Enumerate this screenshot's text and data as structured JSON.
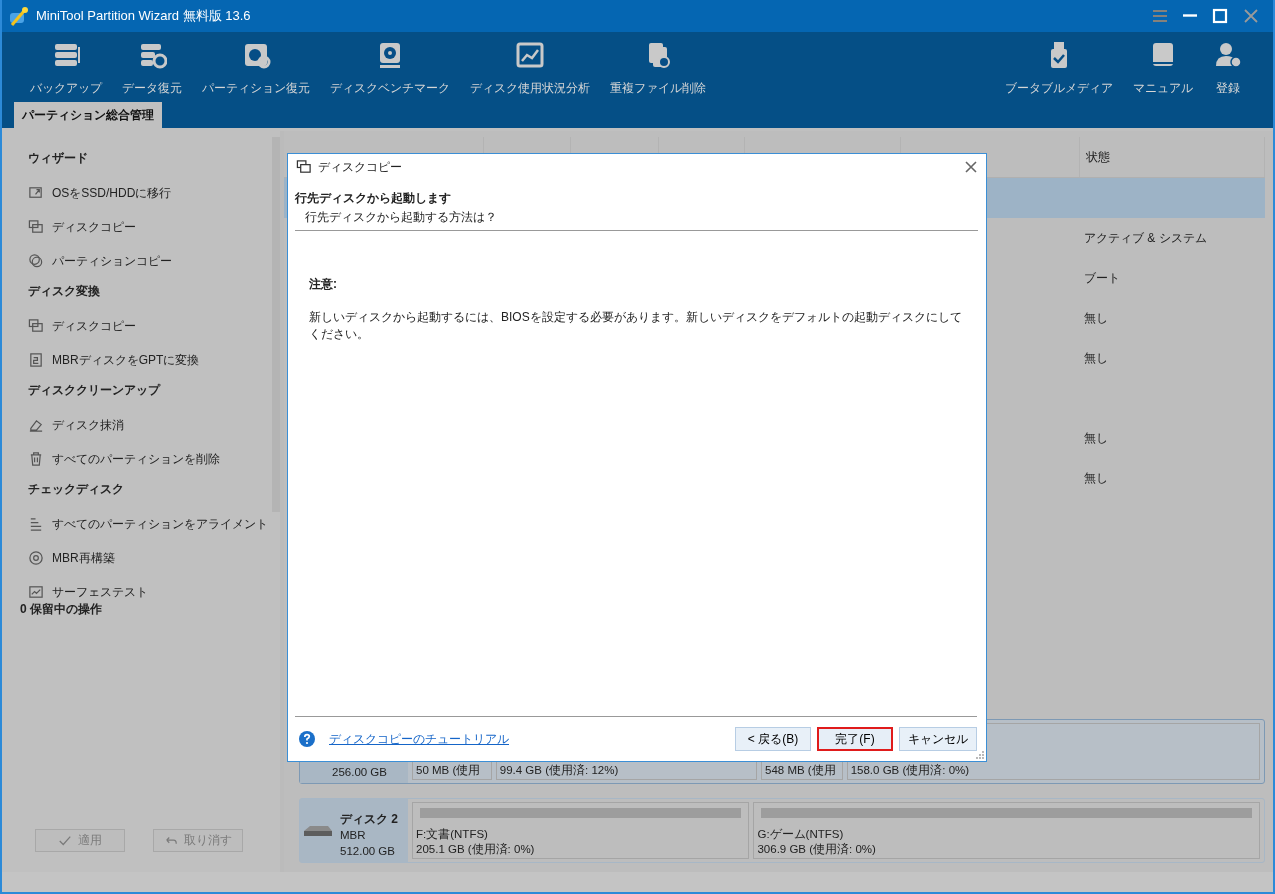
{
  "window": {
    "title": "MiniTool Partition Wizard 無料版 13.6"
  },
  "toolbar": {
    "left": [
      {
        "label": "バックアップ",
        "kind": "stack"
      },
      {
        "label": "データ復元",
        "kind": "datarecover"
      },
      {
        "label": "パーティション復元",
        "kind": "partrecover"
      },
      {
        "label": "ディスクベンチマーク",
        "kind": "benchmark"
      },
      {
        "label": "ディスク使用状況分析",
        "kind": "chart"
      },
      {
        "label": "重複ファイル削除",
        "kind": "duplicate"
      }
    ],
    "right": [
      {
        "label": "ブータブルメディア",
        "kind": "usb"
      },
      {
        "label": "マニュアル",
        "kind": "book"
      },
      {
        "label": "登録",
        "kind": "user"
      }
    ]
  },
  "tabs": [
    {
      "label": "パーティション総合管理",
      "selected": true
    }
  ],
  "sidebar": {
    "sections": [
      {
        "title": "ウィザード",
        "items": [
          {
            "label": "OSをSSD/HDDに移行",
            "kind": "migrate"
          },
          {
            "label": "ディスクコピー",
            "kind": "diskcopy"
          },
          {
            "label": "パーティションコピー",
            "kind": "partcopy"
          }
        ]
      },
      {
        "title": "ディスク変換",
        "items": [
          {
            "label": "ディスクコピー",
            "kind": "diskcopy"
          },
          {
            "label": "MBRディスクをGPTに変換",
            "kind": "convert"
          }
        ]
      },
      {
        "title": "ディスククリーンアップ",
        "items": [
          {
            "label": "ディスク抹消",
            "kind": "eraser"
          },
          {
            "label": "すべてのパーティションを削除",
            "kind": "trash"
          }
        ]
      },
      {
        "title": "チェックディスク",
        "items": [
          {
            "label": "すべてのパーティションをアライメント",
            "kind": "align"
          },
          {
            "label": "MBR再構築",
            "kind": "rebuild"
          },
          {
            "label": "サーフェステスト",
            "kind": "surface"
          }
        ]
      }
    ],
    "pending": "0 保留中の操作",
    "buttons": [
      {
        "label": "適用",
        "kind": "apply",
        "disabled": true
      },
      {
        "label": "取り消す",
        "kind": "undo",
        "disabled": true
      }
    ]
  },
  "table": {
    "columns": [
      {
        "label": "状態"
      }
    ],
    "rows": [
      {
        "selected": true
      },
      {
        "status": "アクティブ & システム",
        "selected": false
      },
      {
        "status": "ブート",
        "selected": false
      },
      {
        "status": "無し",
        "selected": false
      },
      {
        "status": "無し",
        "selected": false
      },
      {
        "selected": false
      },
      {
        "status": "無し",
        "selected": false
      },
      {
        "status": "無し",
        "selected": false
      }
    ]
  },
  "disk_map": {
    "disks": [
      {
        "size": "256.00 GB",
        "selected": true,
        "partitions": [
          {
            "detail": "50 MB (使用"
          },
          {
            "detail": "99.4 GB (使用済: 12%)"
          },
          {
            "detail": "548 MB (使用"
          },
          {
            "detail": "158.0 GB (使用済: 0%)"
          }
        ]
      },
      {
        "name": "ディスク 2",
        "type": "MBR",
        "size": "512.00 GB",
        "selected": false,
        "partitions": [
          {
            "label": "F:文書(NTFS)",
            "detail": "205.1 GB (使用済: 0%)"
          },
          {
            "label": "G:ゲーム(NTFS)",
            "detail": "306.9 GB (使用済: 0%)"
          }
        ]
      }
    ]
  },
  "dialog": {
    "title": "ディスクコピー",
    "heading": "行先ディスクから起動します",
    "subheading": "行先ディスクから起動する方法は？",
    "note_title": "注意:",
    "note": "新しいディスクから起動するには、BIOSを設定する必要があります。新しいディスクをデフォルトの起動ディスクにしてください。",
    "help_link": "ディスクコピーのチュートリアル",
    "buttons": [
      {
        "label": "< 戻る(B)",
        "focused": false
      },
      {
        "label": "完了(F)",
        "focused": true
      },
      {
        "label": "キャンセル",
        "focused": false
      }
    ]
  }
}
